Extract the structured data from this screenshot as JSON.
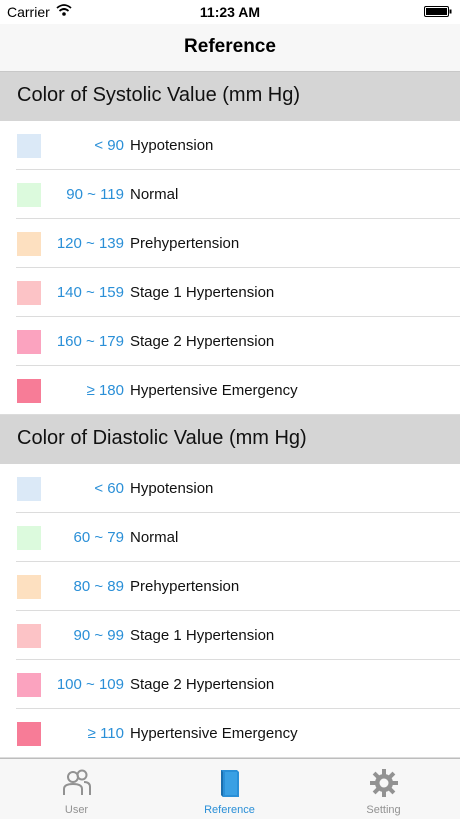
{
  "status": {
    "carrier": "Carrier",
    "time": "11:23 AM"
  },
  "nav": {
    "title": "Reference"
  },
  "systolic": {
    "header": "Color of Systolic Value (mm Hg)",
    "rows": [
      {
        "color": "#dbe9f7",
        "range": "< 90",
        "label": "Hypotension"
      },
      {
        "color": "#dcfadd",
        "range": "90 ~ 119",
        "label": "Normal"
      },
      {
        "color": "#fde0c0",
        "range": "120 ~ 139",
        "label": "Prehypertension"
      },
      {
        "color": "#fcc3c6",
        "range": "140 ~ 159",
        "label": "Stage 1 Hypertension"
      },
      {
        "color": "#fba3bf",
        "range": "160 ~ 179",
        "label": "Stage 2 Hypertension"
      },
      {
        "color": "#f77c97",
        "range": "≥ 180",
        "label": "Hypertensive Emergency"
      }
    ]
  },
  "diastolic": {
    "header": "Color of Diastolic Value (mm Hg)",
    "rows": [
      {
        "color": "#dbe9f7",
        "range": "< 60",
        "label": "Hypotension"
      },
      {
        "color": "#dcfadd",
        "range": "60 ~ 79",
        "label": "Normal"
      },
      {
        "color": "#fde0c0",
        "range": "80 ~ 89",
        "label": "Prehypertension"
      },
      {
        "color": "#fcc3c6",
        "range": "90 ~ 99",
        "label": "Stage 1 Hypertension"
      },
      {
        "color": "#fba3bf",
        "range": "100 ~ 109",
        "label": "Stage 2 Hypertension"
      },
      {
        "color": "#f77c97",
        "range": "≥ 110",
        "label": "Hypertensive Emergency"
      }
    ]
  },
  "tabs": [
    {
      "label": "User",
      "icon": "users-icon",
      "active": false
    },
    {
      "label": "Reference",
      "icon": "book-icon",
      "active": true
    },
    {
      "label": "Setting",
      "icon": "gear-icon",
      "active": false
    }
  ],
  "colors": {
    "accent": "#2a8fd7",
    "inactive": "#929292"
  }
}
